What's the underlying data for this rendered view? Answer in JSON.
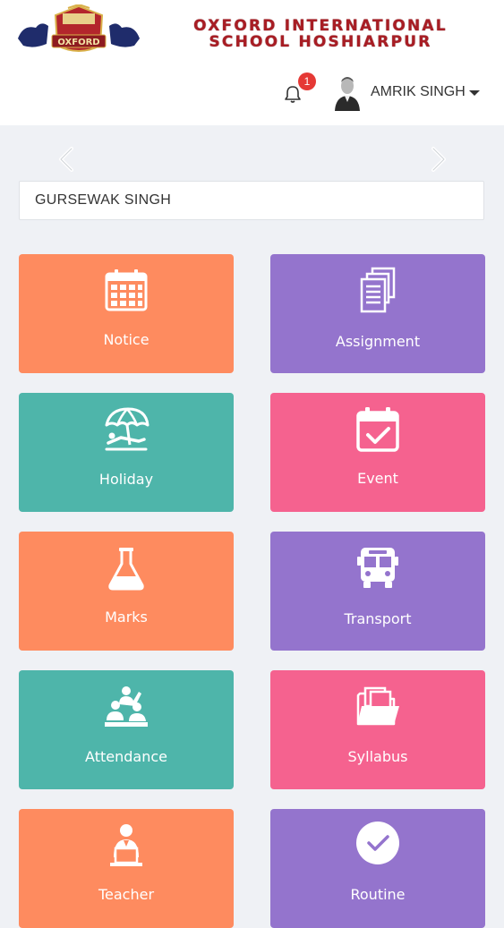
{
  "header": {
    "school_name_line1": "OXFORD INTERNATIONAL",
    "school_name_line2": "SCHOOL HOSHIARPUR",
    "logo_text": "OXFORD",
    "notification_count": "1",
    "user_name": "AMRIK SINGH"
  },
  "student": {
    "name": "GURSEWAK SINGH"
  },
  "tiles": [
    {
      "label": "Notice",
      "icon": "calendar-grid-icon",
      "color": "#fe8b5f"
    },
    {
      "label": "Assignment",
      "icon": "documents-icon",
      "color": "#9474cd"
    },
    {
      "label": "Holiday",
      "icon": "beach-umbrella-icon",
      "color": "#4eb5aa"
    },
    {
      "label": "Event",
      "icon": "calendar-check-icon",
      "color": "#f5628f"
    },
    {
      "label": "Marks",
      "icon": "flask-icon",
      "color": "#fe8b5f"
    },
    {
      "label": "Transport",
      "icon": "bus-icon",
      "color": "#9474cd"
    },
    {
      "label": "Attendance",
      "icon": "classroom-icon",
      "color": "#4eb5aa"
    },
    {
      "label": "Syllabus",
      "icon": "folder-icon",
      "color": "#f5628f"
    },
    {
      "label": "Teacher",
      "icon": "teacher-icon",
      "color": "#fe8b5f"
    },
    {
      "label": "Routine",
      "icon": "check-circle-icon",
      "color": "#9474cd"
    }
  ],
  "colors": {
    "background": "#eff1f5",
    "brand_red": "#a81d24",
    "badge": "#e53935"
  }
}
